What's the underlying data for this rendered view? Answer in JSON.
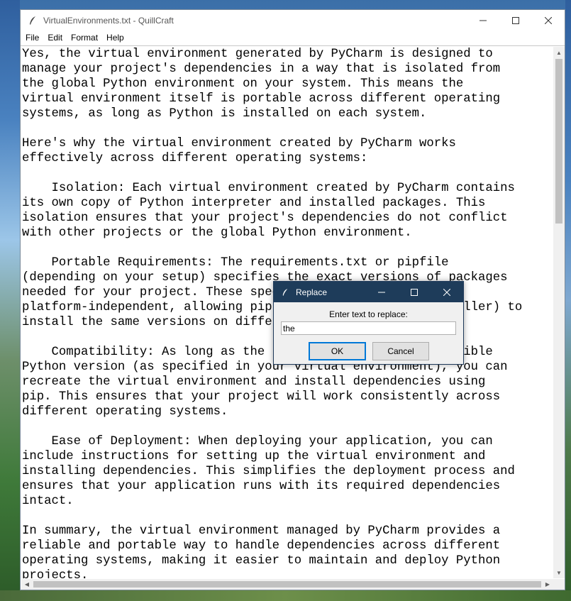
{
  "window": {
    "title": "VirtualEnvironments.txt - QuillCraft",
    "icon": "feather-icon",
    "controls": {
      "minimize": "–",
      "maximize": "☐",
      "close": "✕"
    }
  },
  "menu": [
    {
      "label": "File"
    },
    {
      "label": "Edit"
    },
    {
      "label": "Format"
    },
    {
      "label": "Help"
    }
  ],
  "editor": {
    "lines": [
      "Yes, the virtual environment generated by PyCharm is designed to",
      "manage your project's dependencies in a way that is isolated from",
      "the global Python environment on your system. This means the",
      "virtual environment itself is portable across different operating",
      "systems, as long as Python is installed on each system.",
      "",
      "Here's why the virtual environment created by PyCharm works",
      "effectively across different operating systems:",
      "",
      "    Isolation: Each virtual environment created by PyCharm contains",
      "its own copy of Python interpreter and installed packages. This",
      "isolation ensures that your project's dependencies do not conflict",
      "with other projects or the global Python environment.",
      "",
      "    Portable Requirements: The requirements.txt or pipfile",
      "(depending on your setup) specifies the exact versions of packages",
      "needed for your project. These specifications are",
      "platform-independent, allowing pip (the Python package installer) to",
      "install the same versions on different systems.",
      "",
      "    Compatibility: As long as the target system has a compatible",
      "Python version (as specified in your virtual environment), you can",
      "recreate the virtual environment and install dependencies using",
      "pip. This ensures that your project will work consistently across",
      "different operating systems.",
      "",
      "    Ease of Deployment: When deploying your application, you can",
      "include instructions for setting up the virtual environment and",
      "installing dependencies. This simplifies the deployment process and",
      "ensures that your application runs with its required dependencies",
      "intact.",
      "",
      "In summary, the virtual environment managed by PyCharm provides a",
      "reliable and portable way to handle dependencies across different",
      "operating systems, making it easier to maintain and deploy Python",
      "projects."
    ],
    "vertical_scroll_position": 0.0
  },
  "dialog": {
    "title": "Replace",
    "icon": "feather-icon",
    "controls": {
      "minimize": "–",
      "maximize": "☐",
      "close": "✕"
    },
    "prompt": "Enter text to replace:",
    "input_value": "the",
    "ok_label": "OK",
    "cancel_label": "Cancel"
  }
}
